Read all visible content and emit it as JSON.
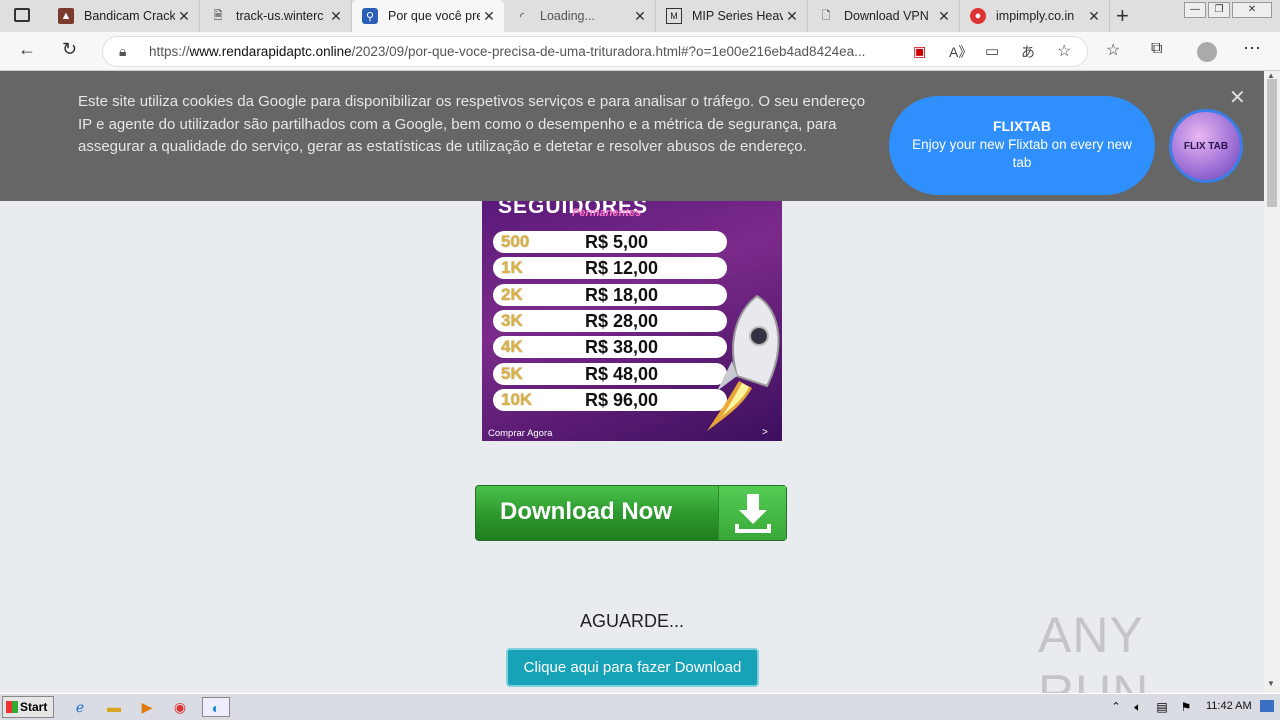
{
  "tabs": [
    {
      "title": "Bandicam Crack",
      "icon": "bandicam-icon",
      "close": "✕"
    },
    {
      "title": "track-us.winterc",
      "icon": "page-icon",
      "close": "✕"
    },
    {
      "title": "Por que você pre",
      "icon": "link-icon",
      "close": "✕"
    },
    {
      "title": "Loading...",
      "icon": "loading-icon",
      "close": "✕"
    },
    {
      "title": "MIP Series Heav",
      "icon": "mip-icon",
      "close": "✕"
    },
    {
      "title": "Download VPN",
      "icon": "document-icon",
      "close": "✕"
    },
    {
      "title": "impimply.co.in",
      "icon": "globe-icon",
      "close": "✕"
    }
  ],
  "new_tab": "+",
  "address": {
    "prefix": "https://",
    "domain": "www.rendarapidaptc.online",
    "path": "/2023/09/por-que-voce-precisa-de-uma-trituradora.html#?o=1e00e216eb4ad8424ea..."
  },
  "cookie_banner": {
    "text": "Este site utiliza cookies da Google para disponibilizar os respetivos serviços e para analisar o tráfego. O seu endereço IP e agente do utilizador são partilhados com a Google, bem como o desempenho e a métrica de segurança, para assegurar a qualidade do serviço, gerar as estatísticas de utilização e detetar e resolver abusos de endereço.",
    "close": "✕"
  },
  "flixtab": {
    "title": "FLIXTAB",
    "subtitle": "Enjoy your new Flixtab on every new tab",
    "logo_text": "FLIX TAB"
  },
  "ad": {
    "headline": "SEGUIDORES",
    "subheadline": "Permanentes",
    "prices": [
      {
        "qty": "500",
        "price": "R$ 5,00"
      },
      {
        "qty": "1K",
        "price": "R$ 12,00"
      },
      {
        "qty": "2K",
        "price": "R$ 18,00"
      },
      {
        "qty": "3K",
        "price": "R$ 28,00"
      },
      {
        "qty": "4K",
        "price": "R$ 38,00"
      },
      {
        "qty": "5K",
        "price": "R$ 48,00"
      },
      {
        "qty": "10K",
        "price": "R$ 96,00"
      }
    ],
    "cta": "Comprar Agora",
    "cta_arrow": ">"
  },
  "download_button": "Download Now",
  "wait_text": "AGUARDE...",
  "click_button": "Clique aqui para fazer Download",
  "watermark": "ANY RUN",
  "taskbar": {
    "start": "Start",
    "clock": "11:42 AM"
  },
  "colors": {
    "cookie_bg": "#666666",
    "flix_blue": "#2f8ffd",
    "download_green": "#2e9a2e",
    "click_teal": "#17a2b8"
  }
}
